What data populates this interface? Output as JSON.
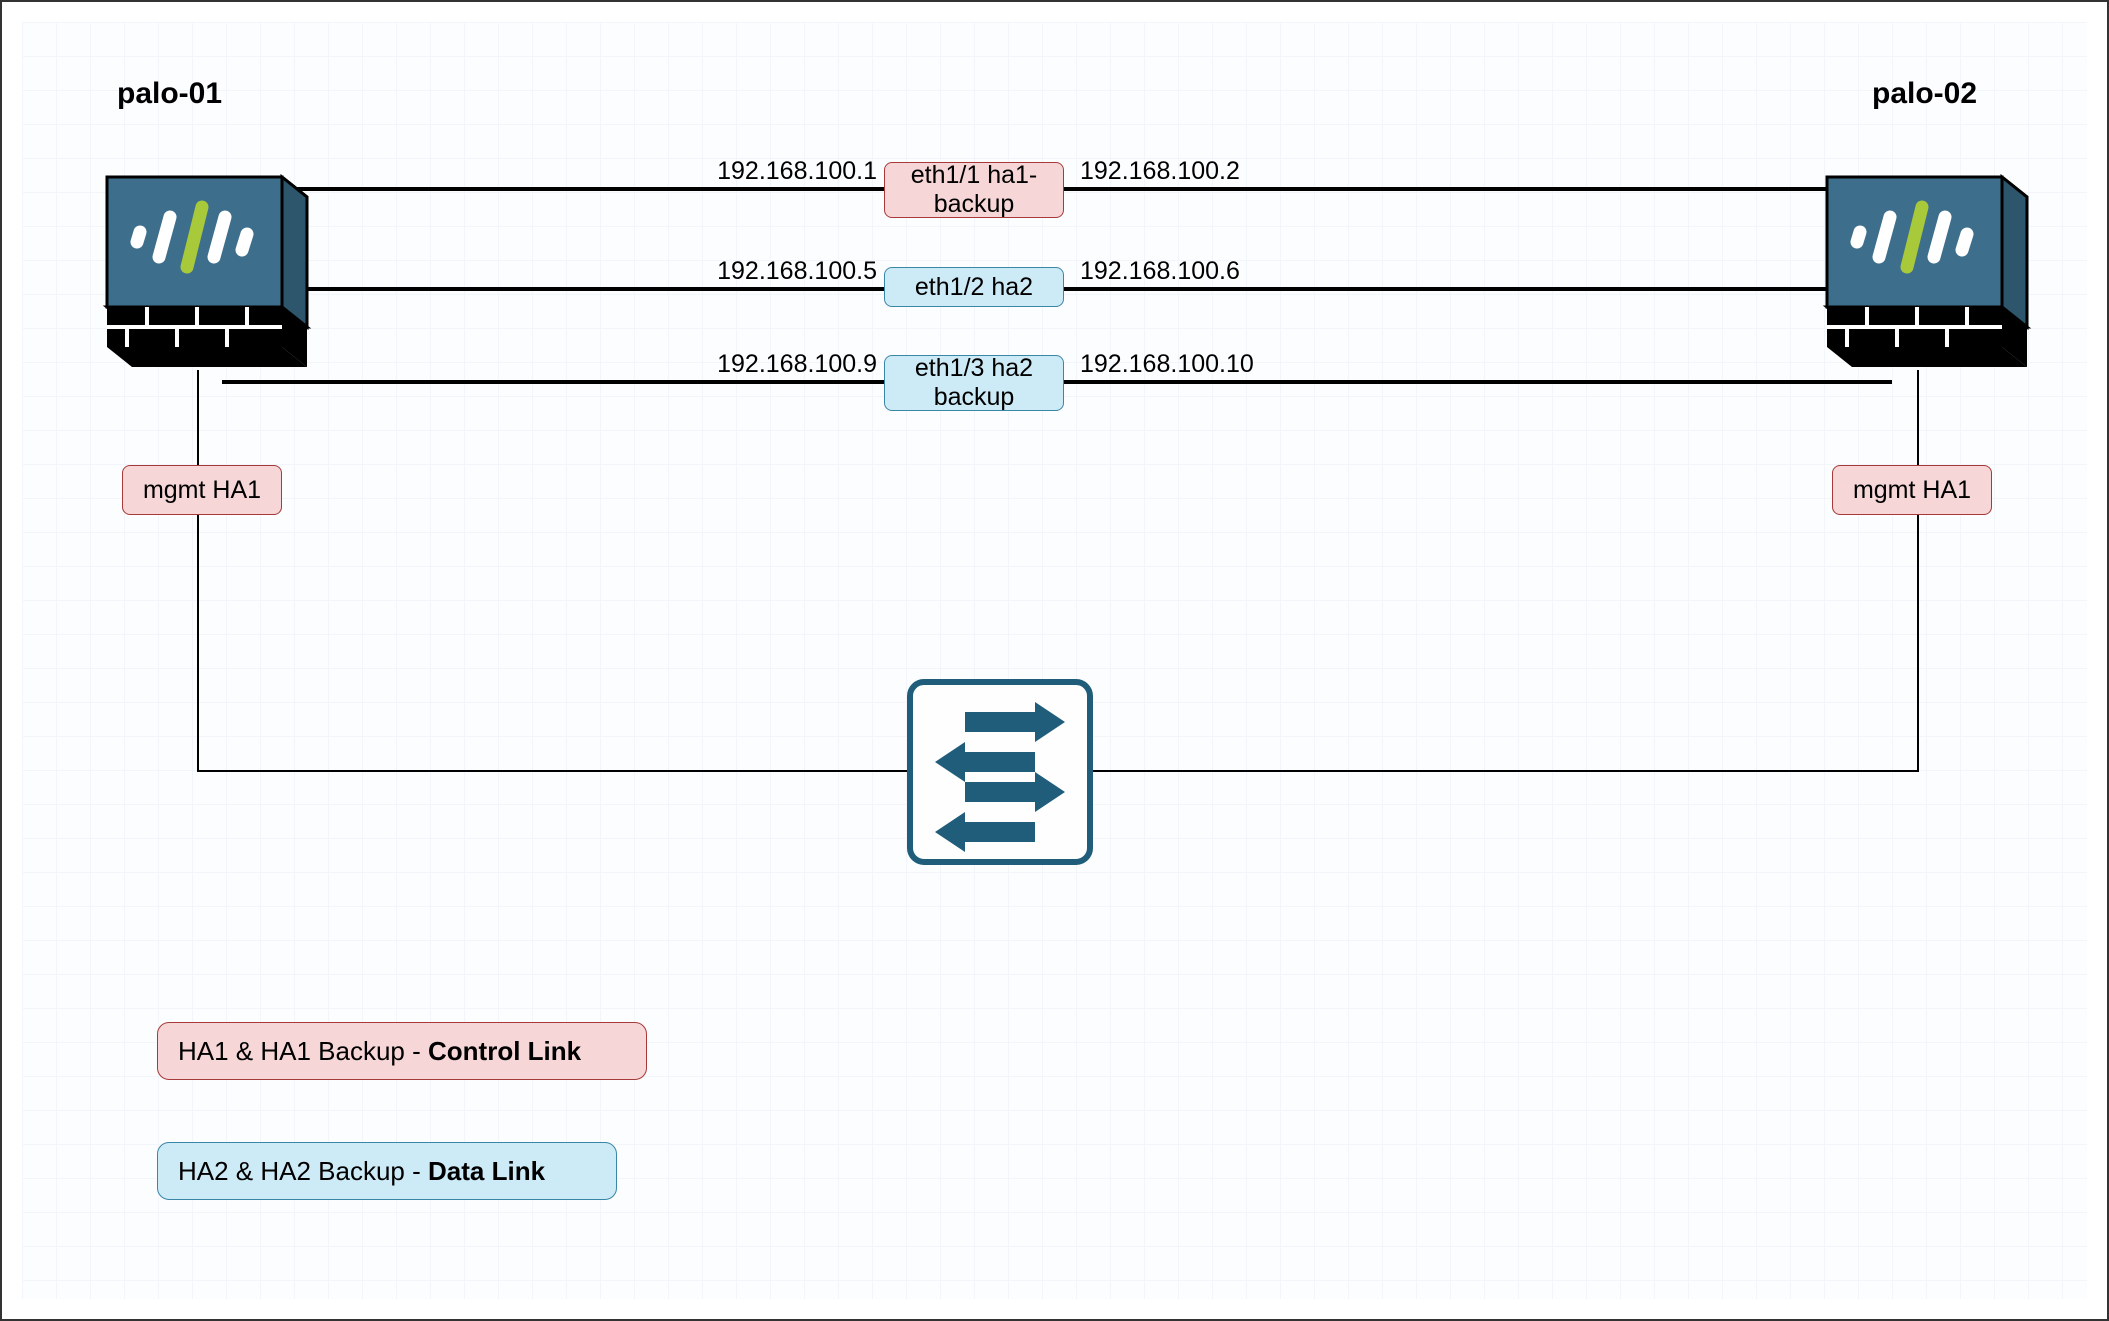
{
  "devices": {
    "left": {
      "name": "palo-01"
    },
    "right": {
      "name": "palo-02"
    }
  },
  "links": {
    "link1": {
      "left_ip": "192.168.100.1",
      "right_ip": "192.168.100.2",
      "label": "eth1/1 ha1-backup"
    },
    "link2": {
      "left_ip": "192.168.100.5",
      "right_ip": "192.168.100.6",
      "label": "eth1/2 ha2"
    },
    "link3": {
      "left_ip": "192.168.100.9",
      "right_ip": "192.168.100.10",
      "label": "eth1/3 ha2 backup"
    }
  },
  "mgmt": {
    "left": "mgmt HA1",
    "right": "mgmt HA1"
  },
  "legend": {
    "control_prefix": "HA1 & HA1 Backup - ",
    "control_bold": "Control Link",
    "data_prefix": "HA2 & HA2 Backup - ",
    "data_bold": "Data Link"
  }
}
